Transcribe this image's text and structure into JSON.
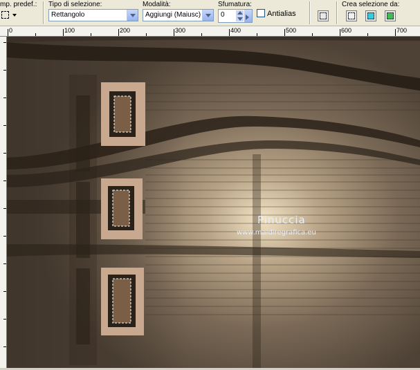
{
  "toolbar": {
    "preset_label": "mp. predef.:",
    "selection_type_label": "Tipo di selezione:",
    "selection_type_value": "Rettangolo",
    "mode_label": "Modalità:",
    "mode_value": "Aggiungi (Maiusc)",
    "feather_label": "Sfumatura:",
    "feather_value": "0",
    "antialias_label": "Antialias",
    "create_selection_label": "Crea selezione da:"
  },
  "ruler": {
    "labels": [
      "0",
      "100",
      "200",
      "300",
      "400",
      "500",
      "600",
      "700"
    ]
  },
  "canvas": {
    "watermark_title": "Pinuccia",
    "watermark_url": "www.maidiregrafica.eu"
  },
  "colors": {
    "toolbar_bg": "#ece9d8",
    "canvas_dark": "#2a2118",
    "canvas_mid": "#6b5a48",
    "canvas_light": "#e8d8bc",
    "frame_fill": "#c9a890"
  }
}
